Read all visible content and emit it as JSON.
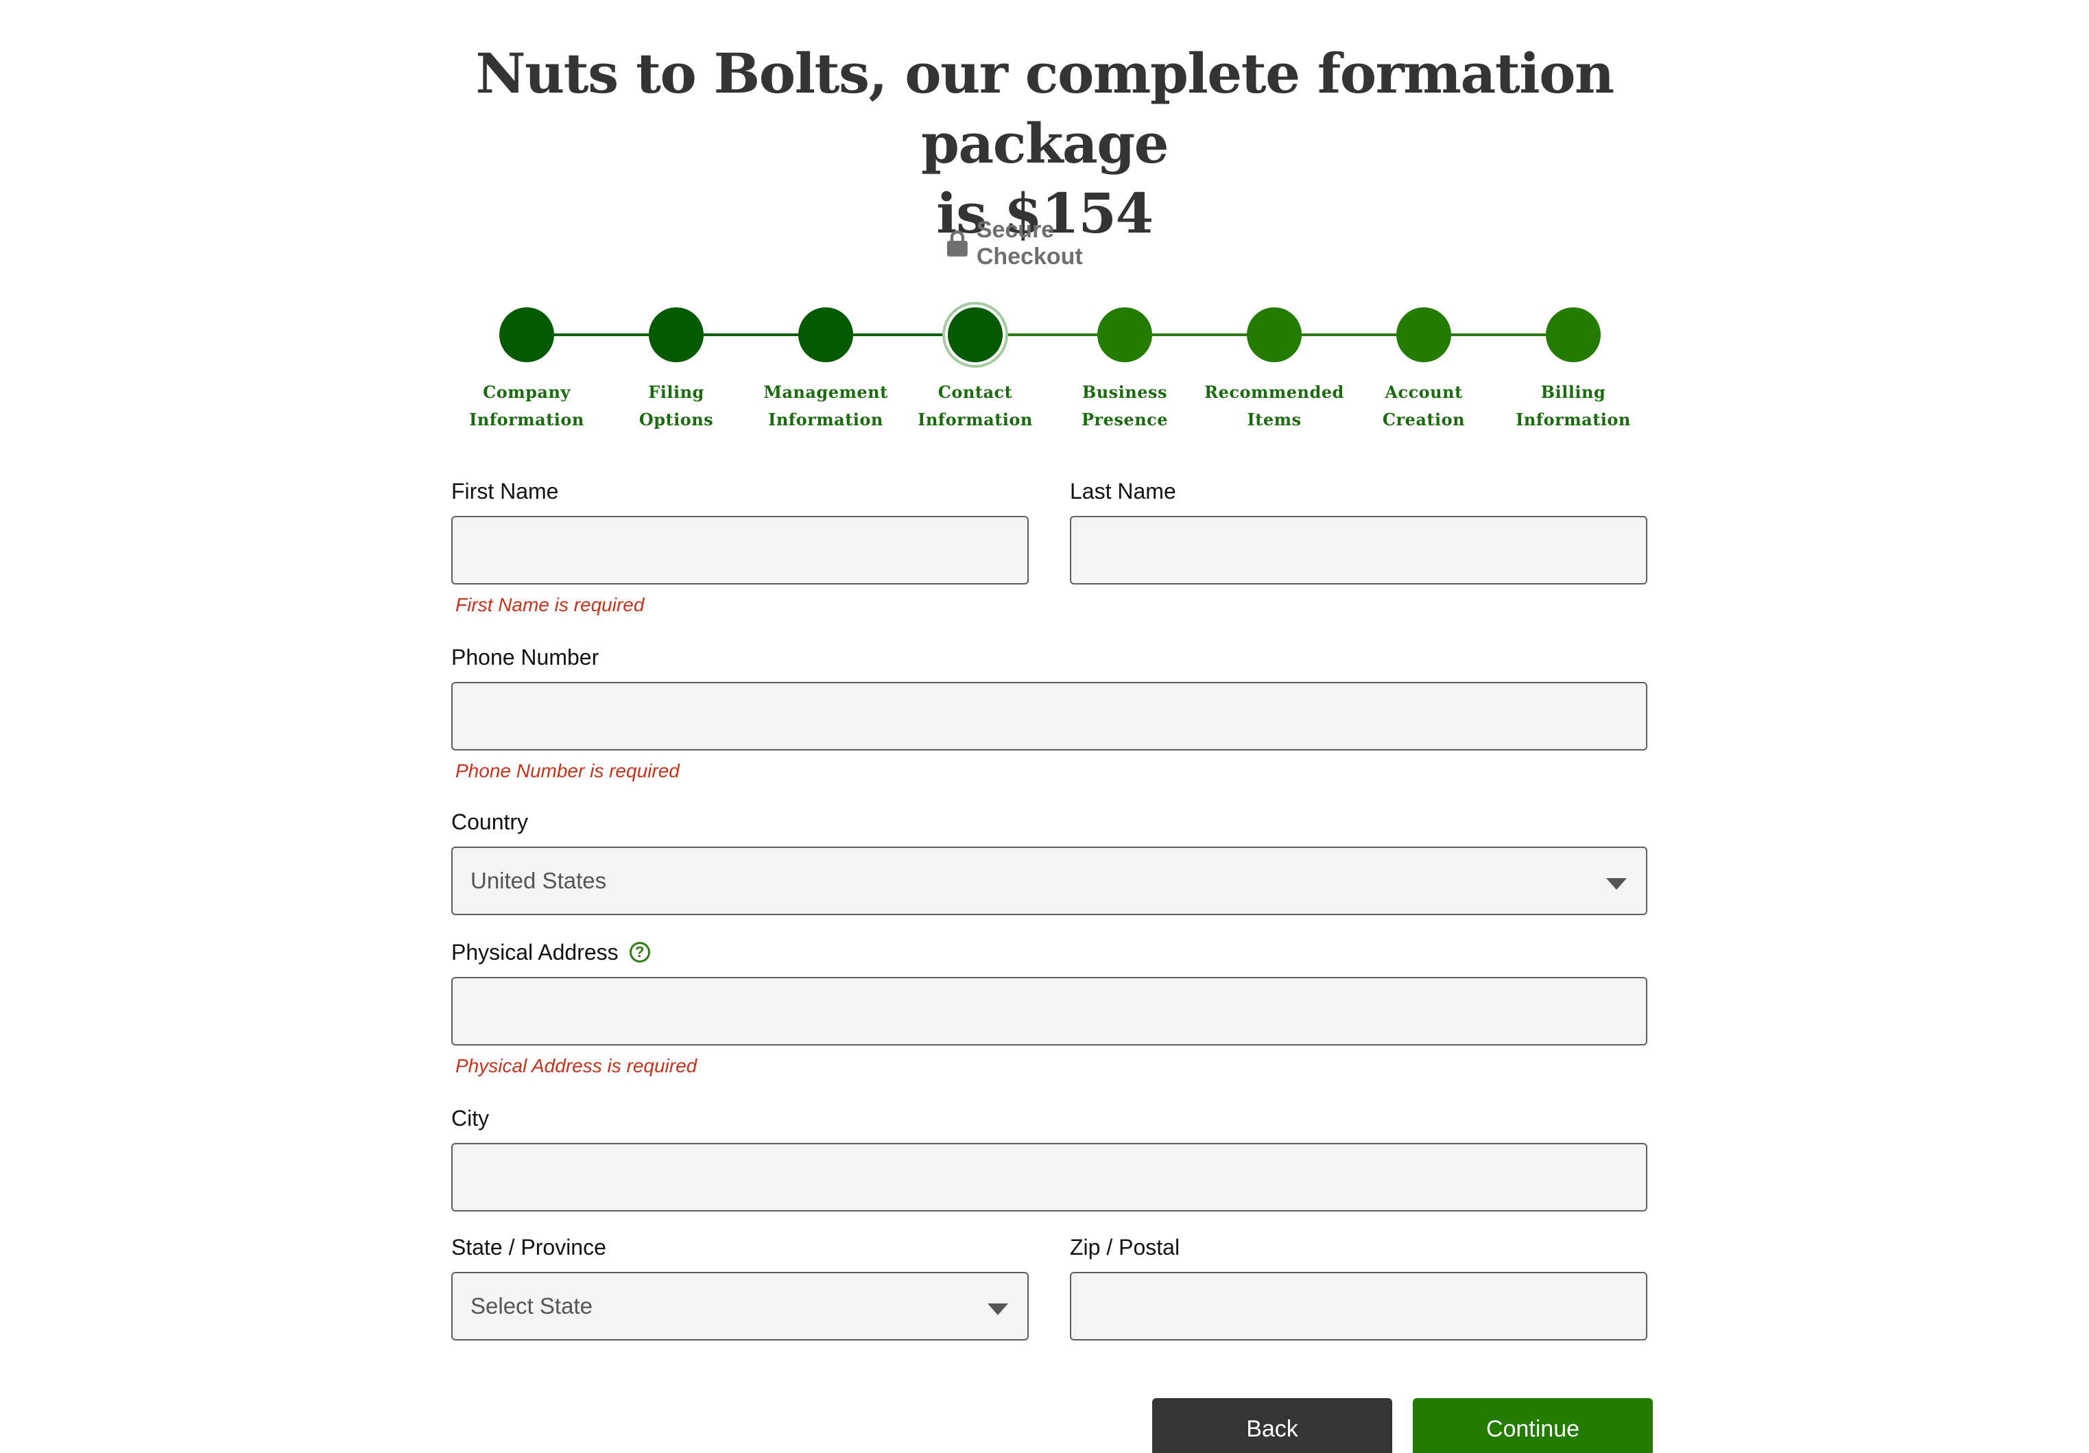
{
  "header": {
    "title_line1": "Nuts to Bolts, our complete formation package",
    "title_line2": "is $154",
    "secure_label": "Secure Checkout",
    "secure_icon": "lock-icon"
  },
  "stepper": {
    "steps": [
      {
        "line1": "Company",
        "line2": "Information",
        "state": "done"
      },
      {
        "line1": "Filing",
        "line2": "Options",
        "state": "done"
      },
      {
        "line1": "Management",
        "line2": "Information",
        "state": "done"
      },
      {
        "line1": "Contact",
        "line2": "Information",
        "state": "current"
      },
      {
        "line1": "Business",
        "line2": "Presence",
        "state": "upcoming"
      },
      {
        "line1": "Recommended",
        "line2": "Items",
        "state": "upcoming"
      },
      {
        "line1": "Account",
        "line2": "Creation",
        "state": "upcoming"
      },
      {
        "line1": "Billing",
        "line2": "Information",
        "state": "upcoming"
      }
    ],
    "colors": {
      "done": "#035a00",
      "upcoming": "#237b00"
    }
  },
  "form": {
    "first_name": {
      "label": "First Name",
      "value": "",
      "error": "First Name is required"
    },
    "last_name": {
      "label": "Last Name",
      "value": ""
    },
    "phone": {
      "label": "Phone Number",
      "value": "",
      "error": "Phone Number is required"
    },
    "country": {
      "label": "Country",
      "value": "United States"
    },
    "address": {
      "label": "Physical Address",
      "help_icon": "?",
      "value": "",
      "error": "Physical Address is required"
    },
    "city": {
      "label": "City",
      "value": ""
    },
    "state": {
      "label": "State / Province",
      "placeholder": "Select State"
    },
    "zip": {
      "label": "Zip / Postal",
      "value": ""
    }
  },
  "buttons": {
    "back": "Back",
    "continue": "Continue"
  },
  "colors": {
    "error": "#c4331a",
    "accent": "#237b00",
    "dark_button": "#353535"
  }
}
